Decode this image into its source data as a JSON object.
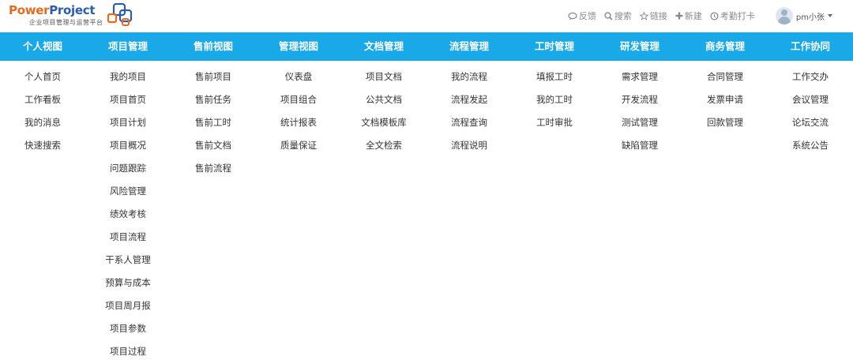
{
  "logo": {
    "word_part1": "Power",
    "word_part2": "Project",
    "subtitle": "企业项目管理与运营平台"
  },
  "topnav": {
    "items": [
      {
        "label": "反馈",
        "icon": "comment-icon"
      },
      {
        "label": "搜索",
        "icon": "search-icon"
      },
      {
        "label": "链接",
        "icon": "star-icon"
      },
      {
        "label": "新建",
        "icon": "plus-icon"
      },
      {
        "label": "考勤打卡",
        "icon": "clock-icon"
      }
    ],
    "user": {
      "name": "pm小张"
    }
  },
  "colors": {
    "menubar_bg": "#19a9e8",
    "logo_orange": "#e86a1e",
    "logo_blue": "#2a5db0"
  },
  "menu": [
    {
      "title": "个人视图",
      "items": [
        "个人首页",
        "工作看板",
        "我的消息",
        "快速搜索"
      ]
    },
    {
      "title": "项目管理",
      "items": [
        "我的项目",
        "项目首页",
        "项目计划",
        "项目概况",
        "问题跟踪",
        "风险管理",
        "绩效考核",
        "项目流程",
        "干系人管理",
        "预算与成本",
        "项目周月报",
        "项目参数",
        "项目过程"
      ]
    },
    {
      "title": "售前视图",
      "items": [
        "售前项目",
        "售前任务",
        "售前工时",
        "售前文档",
        "售前流程"
      ]
    },
    {
      "title": "管理视图",
      "items": [
        "仪表盘",
        "项目组合",
        "统计报表",
        "质量保证"
      ]
    },
    {
      "title": "文档管理",
      "items": [
        "项目文档",
        "公共文档",
        "文档模板库",
        "全文检索"
      ]
    },
    {
      "title": "流程管理",
      "items": [
        "我的流程",
        "流程发起",
        "流程查询",
        "流程说明"
      ]
    },
    {
      "title": "工时管理",
      "items": [
        "填报工时",
        "我的工时",
        "工时审批"
      ]
    },
    {
      "title": "研发管理",
      "items": [
        "需求管理",
        "开发流程",
        "测试管理",
        "缺陷管理"
      ]
    },
    {
      "title": "商务管理",
      "items": [
        "合同管理",
        "发票申请",
        "回款管理"
      ]
    },
    {
      "title": "工作协同",
      "items": [
        "工作交办",
        "会议管理",
        "论坛交流",
        "系统公告"
      ]
    }
  ]
}
